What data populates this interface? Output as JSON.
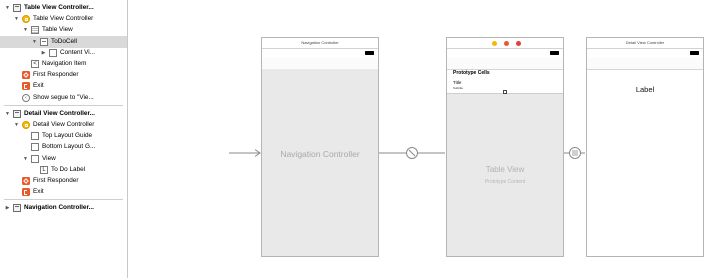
{
  "outline": {
    "rows": [
      {
        "label": "Table View Controller...",
        "bold": true,
        "indent": 0,
        "tri": "▼",
        "icon": "scene",
        "iconName": "scene-icon"
      },
      {
        "label": "Table View Controller",
        "bold": false,
        "indent": 1,
        "tri": "▼",
        "icon": "ctrl",
        "iconName": "view-controller-icon"
      },
      {
        "label": "Table View",
        "bold": false,
        "indent": 2,
        "tri": "▼",
        "icon": "table",
        "iconName": "table-view-icon"
      },
      {
        "label": "ToDoCell",
        "bold": false,
        "indent": 3,
        "tri": "▼",
        "icon": "cell",
        "iconName": "table-cell-icon",
        "selected": true
      },
      {
        "label": "Content Vi...",
        "bold": false,
        "indent": 4,
        "tri": "▶",
        "icon": "view",
        "iconName": "content-view-icon"
      },
      {
        "label": "Navigation Item",
        "bold": false,
        "indent": 2,
        "tri": "",
        "icon": "nav",
        "iconName": "navigation-item-icon",
        "glyph": "<"
      },
      {
        "label": "First Responder",
        "bold": false,
        "indent": 1,
        "tri": "",
        "icon": "cube",
        "iconName": "first-responder-icon"
      },
      {
        "label": "Exit",
        "bold": false,
        "indent": 1,
        "tri": "",
        "icon": "exit",
        "iconName": "exit-icon"
      },
      {
        "label": "Show segue to \"Vie...",
        "bold": false,
        "indent": 1,
        "tri": "",
        "icon": "segue",
        "iconName": "segue-icon",
        "glyph": "‹"
      },
      {
        "sep": true
      },
      {
        "label": "Detail View Controller...",
        "bold": true,
        "indent": 0,
        "tri": "▼",
        "icon": "scene",
        "iconName": "scene-icon"
      },
      {
        "label": "Detail View Controller",
        "bold": false,
        "indent": 1,
        "tri": "▼",
        "icon": "ctrl",
        "iconName": "view-controller-icon"
      },
      {
        "label": "Top Layout Guide",
        "bold": false,
        "indent": 2,
        "tri": "",
        "icon": "view",
        "iconName": "layout-guide-icon"
      },
      {
        "label": "Bottom Layout G...",
        "bold": false,
        "indent": 2,
        "tri": "",
        "icon": "view",
        "iconName": "layout-guide-icon"
      },
      {
        "label": "View",
        "bold": false,
        "indent": 2,
        "tri": "▼",
        "icon": "view",
        "iconName": "view-icon"
      },
      {
        "label": "To Do Label",
        "bold": false,
        "indent": 3,
        "tri": "",
        "icon": "label",
        "iconName": "label-icon",
        "glyph": "L"
      },
      {
        "label": "First Responder",
        "bold": false,
        "indent": 1,
        "tri": "",
        "icon": "cube",
        "iconName": "first-responder-icon"
      },
      {
        "label": "Exit",
        "bold": false,
        "indent": 1,
        "tri": "",
        "icon": "exit",
        "iconName": "exit-icon"
      },
      {
        "sep": true
      },
      {
        "label": "Navigation Controller...",
        "bold": true,
        "indent": 0,
        "tri": "▶",
        "icon": "scene",
        "iconName": "scene-icon"
      }
    ]
  },
  "canvas": {
    "nav_scene": {
      "dock_title": "Navigation Controller",
      "title": "Navigation Controller"
    },
    "table_scene": {
      "prototype_cells": "Prototype Cells",
      "cell_title": "Title",
      "cell_subtitle": "Subtitle",
      "table_view": "Table View",
      "prototype_content": "Prototype Content"
    },
    "detail_scene": {
      "dock_title": "Detail View Controller",
      "label": "Label"
    },
    "colors": {
      "dock_yellow": "#f5b800",
      "dock_orange": "#e8582d",
      "dock_red": "#e0403a",
      "scene_border": "#b5b5b5",
      "placeholder_gray": "#e9e9e9",
      "connector": "#8a8a8a"
    }
  }
}
